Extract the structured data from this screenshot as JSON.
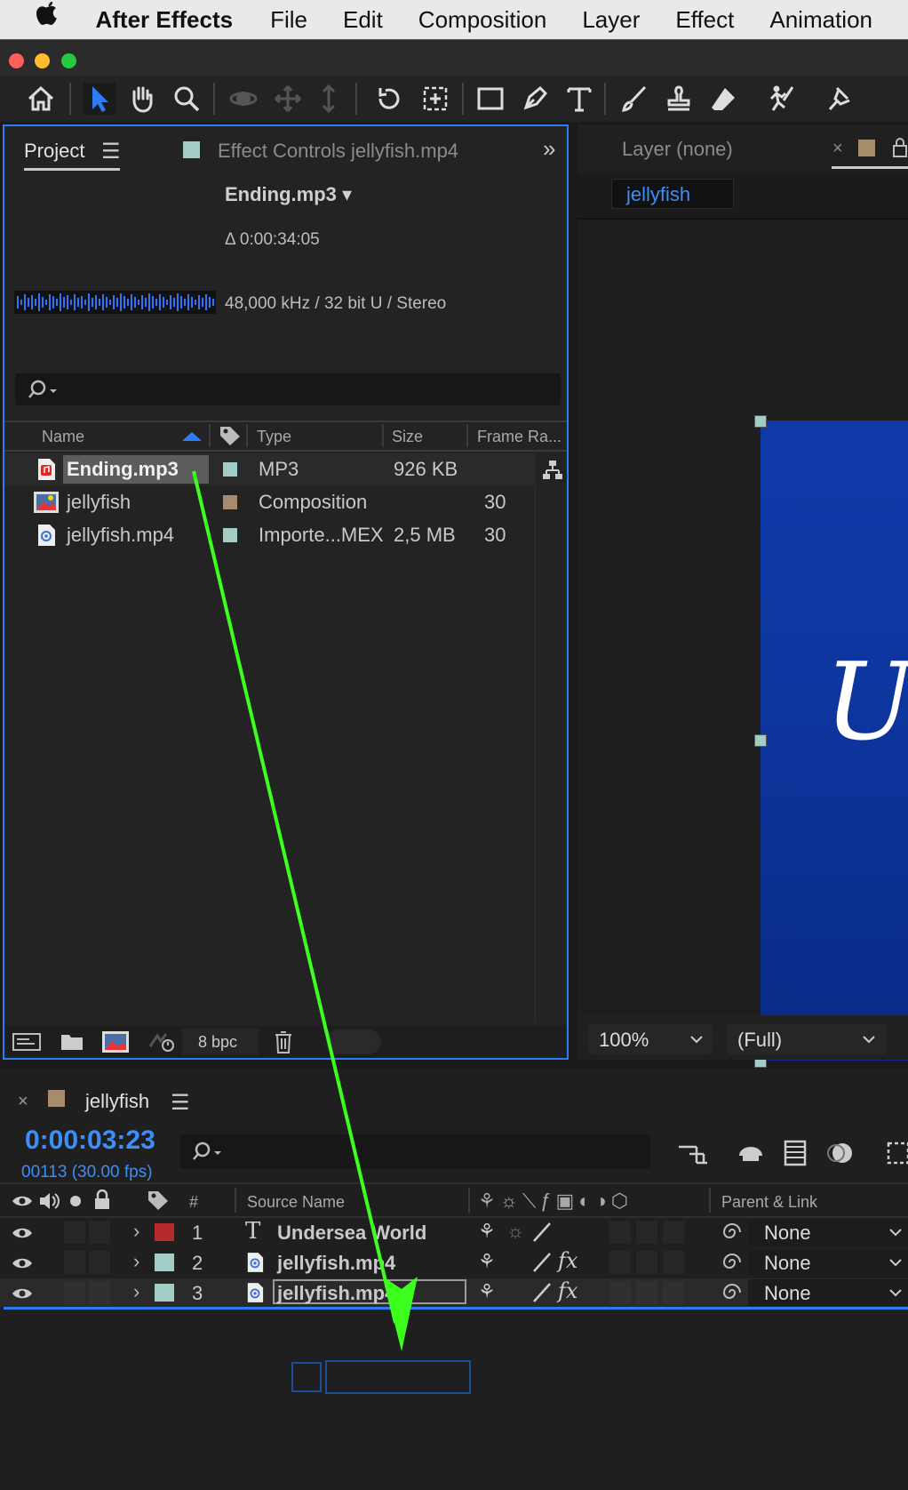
{
  "menubar": {
    "app": "After Effects",
    "items": [
      "File",
      "Edit",
      "Composition",
      "Layer",
      "Effect",
      "Animation"
    ]
  },
  "colors": {
    "accent_blue": "#2d7cf6",
    "timecode_blue": "#3d8ef7",
    "arrow_green": "#3cff1e",
    "label_red": "#b52a2a",
    "label_aqua": "#a2cdc6",
    "label_tan": "#a68c6b",
    "comp_bg": "#0f3aa8"
  },
  "project_panel": {
    "tab_project": "Project",
    "tab_effect_controls": "Effect Controls jellyfish.mp4",
    "selected_item": "Ending.mp3 ▾",
    "duration": "Δ 0:00:34:05",
    "audio_info": "48,000 kHz / 32 bit U / Stereo",
    "search_placeholder": "",
    "columns": {
      "name": "Name",
      "type": "Type",
      "size": "Size",
      "frame_rate": "Frame Ra..."
    },
    "items": [
      {
        "name": "Ending.mp3",
        "type": "MP3",
        "size": "926 KB",
        "fps": "",
        "icon": "audio-file-icon",
        "label_color": "#a2cdc6",
        "selected": true
      },
      {
        "name": "jellyfish",
        "type": "Composition",
        "size": "",
        "fps": "30",
        "icon": "composition-icon",
        "label_color": "#a68c6b",
        "selected": false
      },
      {
        "name": "jellyfish.mp4",
        "type": "Importe...MEX",
        "size": "2,5 MB",
        "fps": "30",
        "icon": "video-file-icon",
        "label_color": "#a2cdc6",
        "selected": false
      }
    ],
    "bit_depth": "8 bpc"
  },
  "viewer_panel": {
    "tab_layer": "Layer (none)",
    "comp_tab": "jellyfish",
    "zoom": "100%",
    "resolution": "(Full)",
    "overlay_text": "U"
  },
  "timeline_panel": {
    "comp_name": "jellyfish",
    "timecode": "0:00:03:23",
    "frame_info": "00113 (30.00 fps)",
    "columns": {
      "number": "#",
      "source_name": "Source Name",
      "parent_link": "Parent & Link"
    },
    "layers": [
      {
        "num": "1",
        "name": "Undersea World",
        "type": "text",
        "label_color": "#b52a2a",
        "parent": "None",
        "fx": false
      },
      {
        "num": "2",
        "name": "jellyfish.mp4",
        "type": "footage",
        "label_color": "#a2cdc6",
        "parent": "None",
        "fx": true
      },
      {
        "num": "3",
        "name": "jellyfish.mp4",
        "type": "footage",
        "label_color": "#a2cdc6",
        "parent": "None",
        "fx": true
      }
    ]
  }
}
